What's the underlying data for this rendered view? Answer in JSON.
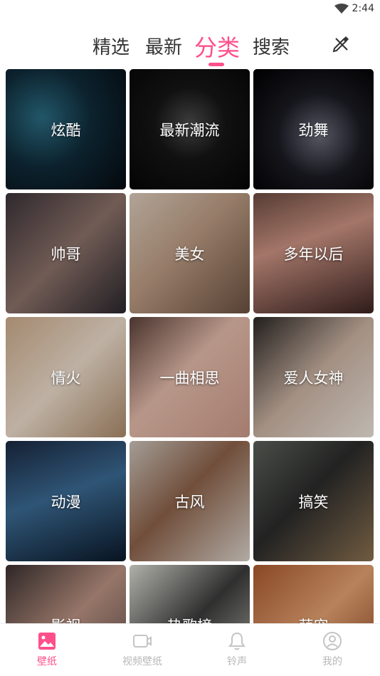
{
  "status_bar": {
    "time": "2:44",
    "icons": [
      "wifi-icon"
    ]
  },
  "top_tabs": {
    "items": [
      {
        "label": "精选",
        "active": false
      },
      {
        "label": "最新",
        "active": false
      },
      {
        "label": "分类",
        "active": true
      },
      {
        "label": "搜索",
        "active": false
      }
    ],
    "edit_icon": "brush-edit-icon",
    "accent_color": "#ff4f8b"
  },
  "categories": [
    {
      "label": "炫酷"
    },
    {
      "label": "最新潮流"
    },
    {
      "label": "劲舞"
    },
    {
      "label": "帅哥"
    },
    {
      "label": "美女"
    },
    {
      "label": "多年以后"
    },
    {
      "label": "情火"
    },
    {
      "label": "一曲相思"
    },
    {
      "label": "爱人女神"
    },
    {
      "label": "动漫"
    },
    {
      "label": "古风"
    },
    {
      "label": "搞笑"
    },
    {
      "label": "影视"
    },
    {
      "label": "热歌榜"
    },
    {
      "label": "萌宠"
    }
  ],
  "bottom_nav": {
    "items": [
      {
        "label": "壁纸",
        "icon": "wallpaper-icon",
        "active": true
      },
      {
        "label": "视频壁纸",
        "icon": "video-icon",
        "active": false
      },
      {
        "label": "铃声",
        "icon": "bell-icon",
        "active": false
      },
      {
        "label": "我的",
        "icon": "profile-icon",
        "active": false
      }
    ],
    "active_color": "#ff4f8b",
    "inactive_color": "#b8b8b8"
  }
}
